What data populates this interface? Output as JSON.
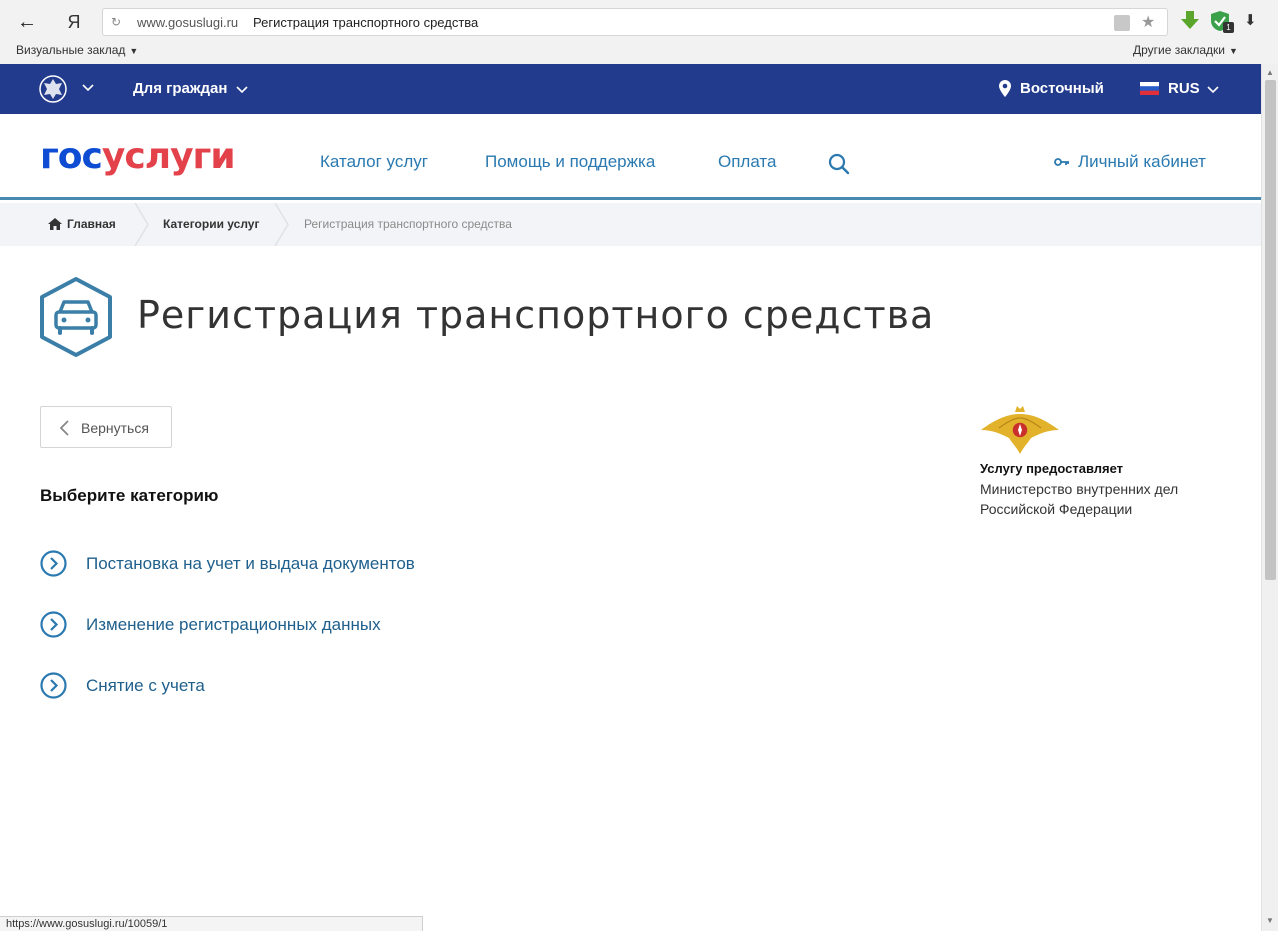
{
  "browser": {
    "back_glyph": "←",
    "yandex_glyph": "Я",
    "reload_glyph": "↻",
    "url_domain": "www.gosuslugi.ru",
    "url_title": "Регистрация транспортного средства",
    "star_glyph": "★",
    "downloads_glyph": "⬇",
    "extension_badge": "1",
    "bookmarks_left": "Визуальные заклад",
    "bookmarks_right": "Другие закладки",
    "caret_glyph": "▼"
  },
  "top_strip": {
    "citizens_label": "Для граждан",
    "location_label": "Восточный",
    "language_label": "RUS"
  },
  "header": {
    "logo_part1": "гос",
    "logo_part2": "услуги",
    "nav": {
      "catalog": "Каталог услуг",
      "help": "Помощь и поддержка",
      "payment": "Оплата"
    },
    "account_label": "Личный кабинет"
  },
  "breadcrumb": {
    "home": "Главная",
    "categories": "Категории услуг",
    "current": "Регистрация транспортного средства"
  },
  "content": {
    "title": "Регистрация транспортного средства",
    "back_button_label": "Вернуться",
    "choose_heading": "Выберите категорию",
    "categories": [
      {
        "label": "Постановка на учет и выдача документов"
      },
      {
        "label": "Изменение регистрационных данных"
      },
      {
        "label": "Снятие с учета"
      }
    ]
  },
  "provider": {
    "caption": "Услугу предоставляет",
    "name_line1": "Министерство внутренних дел",
    "name_line2": "Российской Федерации"
  },
  "status_bar": {
    "url": "https://www.gosuslugi.ru/10059/1"
  },
  "colors": {
    "top_strip_bg": "#233b8c",
    "logo_blue": "#0d4cd3",
    "logo_red": "#e3424b",
    "link_blue": "#2a79b0",
    "category_link": "#1f5f8c",
    "icon_teal": "#3b7fa8"
  }
}
